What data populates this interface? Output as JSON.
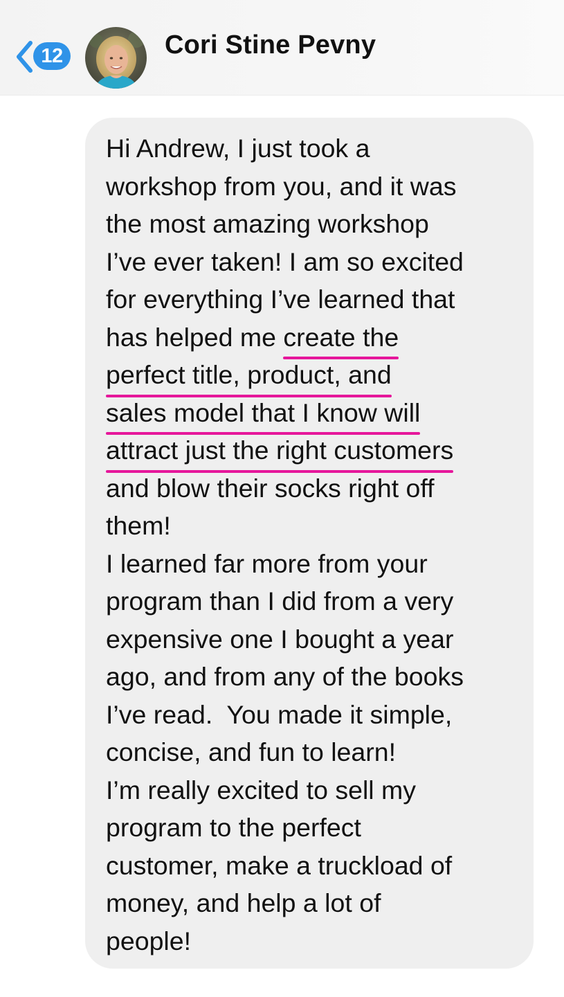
{
  "header": {
    "back_badge": "12",
    "contact_name": "Cori Stine Pevny"
  },
  "message": {
    "lines": [
      {
        "before": "Hi Andrew, I just took a",
        "highlight": ""
      },
      {
        "before": "workshop from you, and it was",
        "highlight": ""
      },
      {
        "before": "the most amazing workshop",
        "highlight": ""
      },
      {
        "before": "I’ve ever taken! I am so excited",
        "highlight": ""
      },
      {
        "before": "for everything I’ve learned that",
        "highlight": ""
      },
      {
        "before": "has helped me ",
        "highlight": "create the"
      },
      {
        "before": "",
        "highlight": "perfect title, product, and"
      },
      {
        "before": "",
        "highlight": "sales model that I know will"
      },
      {
        "before": "",
        "highlight": "attract just the right customers"
      },
      {
        "before": "and blow their socks right off",
        "highlight": ""
      },
      {
        "before": "them!",
        "highlight": ""
      },
      {
        "before": "I learned far more from your",
        "highlight": ""
      },
      {
        "before": "program than I did from a very",
        "highlight": ""
      },
      {
        "before": "expensive one I bought a year",
        "highlight": ""
      },
      {
        "before": "ago, and from any of the books",
        "highlight": ""
      },
      {
        "before": "I’ve read.  You made it simple,",
        "highlight": ""
      },
      {
        "before": "concise, and fun to learn!",
        "highlight": ""
      },
      {
        "before": "I’m really excited to sell my",
        "highlight": ""
      },
      {
        "before": "program to the perfect",
        "highlight": ""
      },
      {
        "before": "customer, make a truckload of",
        "highlight": ""
      },
      {
        "before": "money, and help a lot of",
        "highlight": ""
      },
      {
        "before": "people!",
        "highlight": ""
      }
    ]
  },
  "colors": {
    "accent_blue": "#2f93e8",
    "highlight_underline": "#e6179b",
    "bubble_background": "#efefef"
  },
  "icons": {
    "back": "chevron-left-icon",
    "avatar": "contact-avatar-photo"
  }
}
